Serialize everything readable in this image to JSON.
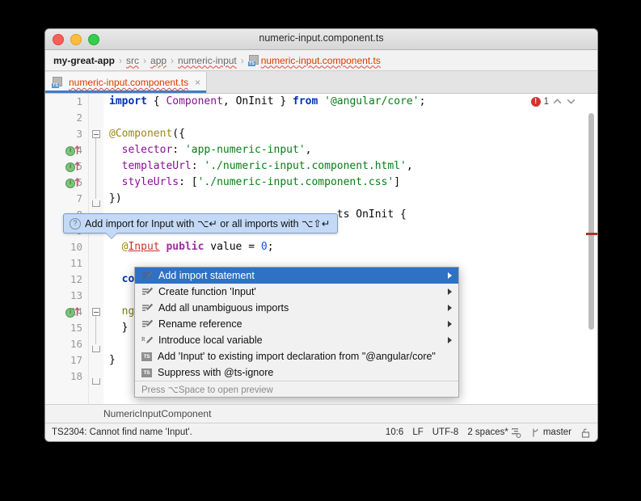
{
  "window": {
    "title": "numeric-input.component.ts",
    "traffic_lights": [
      "close",
      "minimize",
      "zoom"
    ]
  },
  "breadcrumb": {
    "root": "my-great-app",
    "separator": "›",
    "items": [
      "src",
      "app",
      "numeric-input"
    ],
    "file": "numeric-input.component.ts",
    "file_icon": "typescript-file-icon"
  },
  "tab": {
    "label": "numeric-input.component.ts",
    "icon": "typescript-file-icon",
    "close": "×"
  },
  "editor": {
    "error_count": "1",
    "error_icon": "error-circle-icon",
    "prev_icon": "chevron-up-icon",
    "next_icon": "chevron-down-icon",
    "lines": [
      {
        "n": "1",
        "html": "<span class='kw'>import</span><span class='plain'> { </span><span class='cls'>Component</span><span class='plain'>, </span><span class='plain'>OnInit</span><span class='plain'> } </span><span class='kw'>from</span><span class='plain'> </span><span class='str'>'@angular/core'</span><span class='plain'>;</span>"
      },
      {
        "n": "2",
        "html": ""
      },
      {
        "n": "3",
        "html": "<span class='ann'>@Component</span><span class='plain'>({</span>"
      },
      {
        "n": "4",
        "html": "<span class='plain'>  </span><span class='cls'>selector</span><span class='plain'>: </span><span class='str'>'app-numeric-input'</span><span class='plain'>,</span>"
      },
      {
        "n": "5",
        "html": "<span class='plain'>  </span><span class='cls'>templateUrl</span><span class='plain'>: </span><span class='str'>'./numeric-input.component.html'</span><span class='plain'>,</span>"
      },
      {
        "n": "6",
        "html": "<span class='plain'>  </span><span class='cls'>styleUrls</span><span class='plain'>: [</span><span class='str'>'./numeric-input.component.css'</span><span class='plain'>]</span>"
      },
      {
        "n": "7",
        "html": "<span class='plain'>})</span>"
      },
      {
        "n": "8",
        "html": "<span class='plain'>                                    ts OnInit {</span>"
      },
      {
        "n": "9",
        "html": ""
      },
      {
        "n": "10",
        "html": "<span class='plain'>  </span><span class='ann'>@</span><span class='err'>Input</span><span class='plain'> </span><span class='mod'>public</span><span class='plain'> value = </span><span class='num'>0</span><span class='plain'>;</span>"
      },
      {
        "n": "11",
        "html": ""
      },
      {
        "n": "12",
        "html": "<span class='plain'>  </span><span class='kw'>cons</span>"
      },
      {
        "n": "13",
        "html": ""
      },
      {
        "n": "14",
        "html": "<span class='plain'>  </span><span class='fn'>ngOn</span>"
      },
      {
        "n": "15",
        "html": "<span class='plain'>  }</span>"
      },
      {
        "n": "16",
        "html": ""
      },
      {
        "n": "17",
        "html": "<span class='plain'>}</span>"
      },
      {
        "n": "18",
        "html": ""
      }
    ],
    "gutter_marker_lines": [
      "4",
      "5",
      "6",
      "14"
    ],
    "gutter_marker_icon": "bean-implements-icon"
  },
  "tooltip": {
    "icon": "question-icon",
    "text": "Add import for Input with ⌥↵ or all imports with ⌥⇧↵"
  },
  "context_menu": {
    "items": [
      {
        "label": "Add import statement",
        "icon": "quickfix-icon",
        "submenu": true,
        "selected": true
      },
      {
        "label": "Create function 'Input'",
        "icon": "quickfix-icon",
        "submenu": true,
        "selected": false
      },
      {
        "label": "Add all unambiguous imports",
        "icon": "quickfix-icon",
        "submenu": true,
        "selected": false
      },
      {
        "label": "Rename reference",
        "icon": "quickfix-icon",
        "submenu": true,
        "selected": false
      },
      {
        "label": "Introduce local variable",
        "icon": "refactor-icon",
        "submenu": true,
        "selected": false
      },
      {
        "label": "Add 'Input' to existing import declaration from \"@angular/core\"",
        "icon": "typescript-badge-icon",
        "submenu": false,
        "selected": false
      },
      {
        "label": "Suppress with @ts-ignore",
        "icon": "typescript-badge-icon",
        "submenu": false,
        "selected": false
      }
    ],
    "footer": "Press ⌥Space to open preview"
  },
  "nav_bar": {
    "symbol": "NumericInputComponent"
  },
  "status_bar": {
    "message": "TS2304: Cannot find name 'Input'.",
    "position": "10:6",
    "line_separator": "LF",
    "encoding": "UTF-8",
    "indent": "2 spaces*",
    "indent_icon": "indent-icon",
    "branch_icon": "branch-icon",
    "branch": "master",
    "lock_icon": "lock-icon"
  },
  "colors": {
    "selection_blue": "#2f72c4",
    "tooltip_blue": "#c3d9f5",
    "error_red": "#d0342c",
    "caret_line": "#fdf6e3",
    "tab_underline": "#3d7fc1"
  }
}
